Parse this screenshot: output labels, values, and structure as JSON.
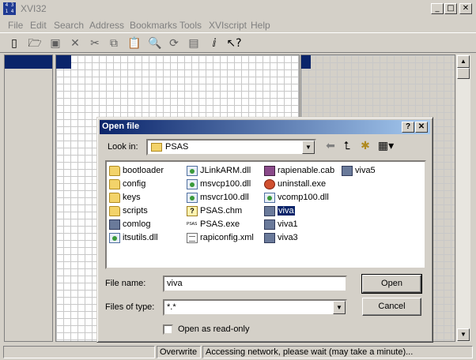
{
  "window": {
    "title": "XVI32",
    "app_icon_text": "4 3 1 4",
    "minimize": "_",
    "maximize": "□",
    "close": "✕"
  },
  "menu": [
    "File",
    "Edit",
    "Search",
    "Address",
    "Bookmarks",
    "Tools",
    "XVIscript",
    "Help"
  ],
  "toolbar": {
    "icons": [
      "new-icon",
      "open-icon",
      "save-icon",
      "delete-icon",
      "cut-icon",
      "copy-icon",
      "paste-icon",
      "find-icon",
      "replace-icon",
      "properties-icon",
      "info-icon",
      "help-icon"
    ],
    "glyphs": [
      "▯",
      "🗁",
      "▣",
      "✕",
      "✂",
      "⧉",
      "📋",
      "🔍",
      "⟳",
      "▤",
      "ⅈ",
      "↖?"
    ]
  },
  "dialog": {
    "title": "Open file",
    "help_btn": "?",
    "close_btn": "✕",
    "look_in_label": "Look in:",
    "look_in_value": "PSAS",
    "files": [
      {
        "name": "bootloader",
        "type": "folder",
        "glyph": ""
      },
      {
        "name": "config",
        "type": "folder",
        "glyph": ""
      },
      {
        "name": "keys",
        "type": "folder",
        "glyph": ""
      },
      {
        "name": "scripts",
        "type": "folder",
        "glyph": ""
      },
      {
        "name": "comlog",
        "type": "app",
        "glyph": ""
      },
      {
        "name": "itsutils.dll",
        "type": "dll",
        "glyph": ""
      },
      {
        "name": "JLinkARM.dll",
        "type": "dll",
        "glyph": ""
      },
      {
        "name": "msvcp100.dll",
        "type": "dll",
        "glyph": ""
      },
      {
        "name": "msvcr100.dll",
        "type": "dll",
        "glyph": ""
      },
      {
        "name": "PSAS.chm",
        "type": "chm",
        "glyph": "?"
      },
      {
        "name": "PSAS.exe",
        "type": "app",
        "glyph": "PSAS"
      },
      {
        "name": "rapiconfig.xml",
        "type": "doc",
        "glyph": ""
      },
      {
        "name": "rapienable.cab",
        "type": "cab",
        "glyph": ""
      },
      {
        "name": "uninstall.exe",
        "type": "setup",
        "glyph": ""
      },
      {
        "name": "vcomp100.dll",
        "type": "dll",
        "glyph": ""
      },
      {
        "name": "viva",
        "type": "exe",
        "glyph": "",
        "selected": true
      },
      {
        "name": "viva1",
        "type": "exe",
        "glyph": ""
      },
      {
        "name": "viva3",
        "type": "exe",
        "glyph": ""
      },
      {
        "name": "viva5",
        "type": "exe",
        "glyph": ""
      }
    ],
    "file_name_label": "File name:",
    "file_name_value": "viva",
    "files_of_type_label": "Files of type:",
    "files_of_type_value": "*.*",
    "open_button": "Open",
    "cancel_button": "Cancel",
    "readonly_label": "Open as read-only"
  },
  "status": {
    "mode": "Overwrite",
    "message": "Accessing network, please wait (may take a minute)..."
  }
}
